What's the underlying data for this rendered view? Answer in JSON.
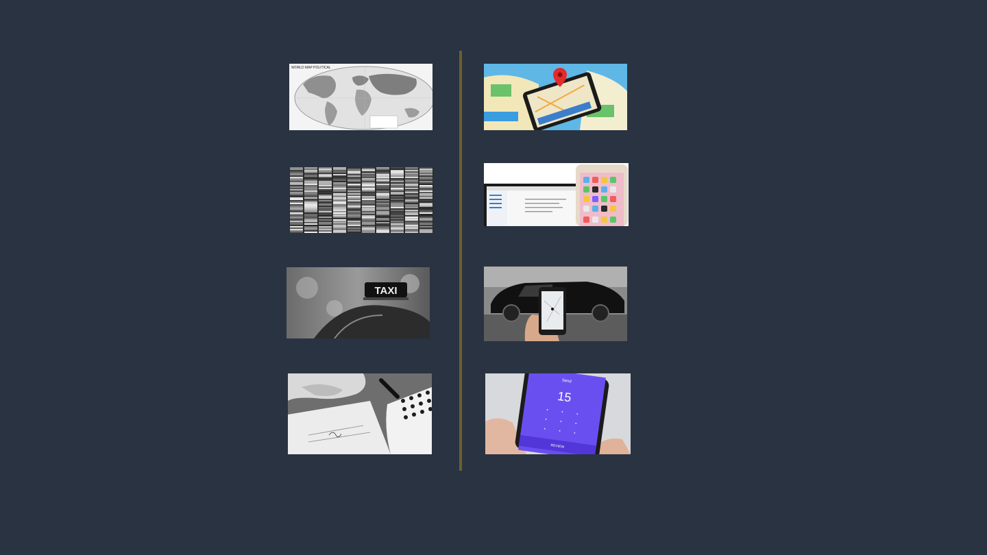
{
  "slide": {
    "background_color": "#2a3342",
    "divider_color": "#6d5f2c"
  },
  "left_column": [
    {
      "name": "world-map-image",
      "caption_text": "WORLD MAP POLITICAL"
    },
    {
      "name": "film-strips-image"
    },
    {
      "name": "taxi-sign-image",
      "sign_text": "TAXI"
    },
    {
      "name": "check-writing-image"
    }
  ],
  "right_column": [
    {
      "name": "phone-map-pin-image"
    },
    {
      "name": "laptop-and-phone-image"
    },
    {
      "name": "ride-hailing-phone-image"
    },
    {
      "name": "payment-app-image",
      "amount_text": "15",
      "header_text": "Send",
      "button_text": "REVIEW"
    }
  ]
}
